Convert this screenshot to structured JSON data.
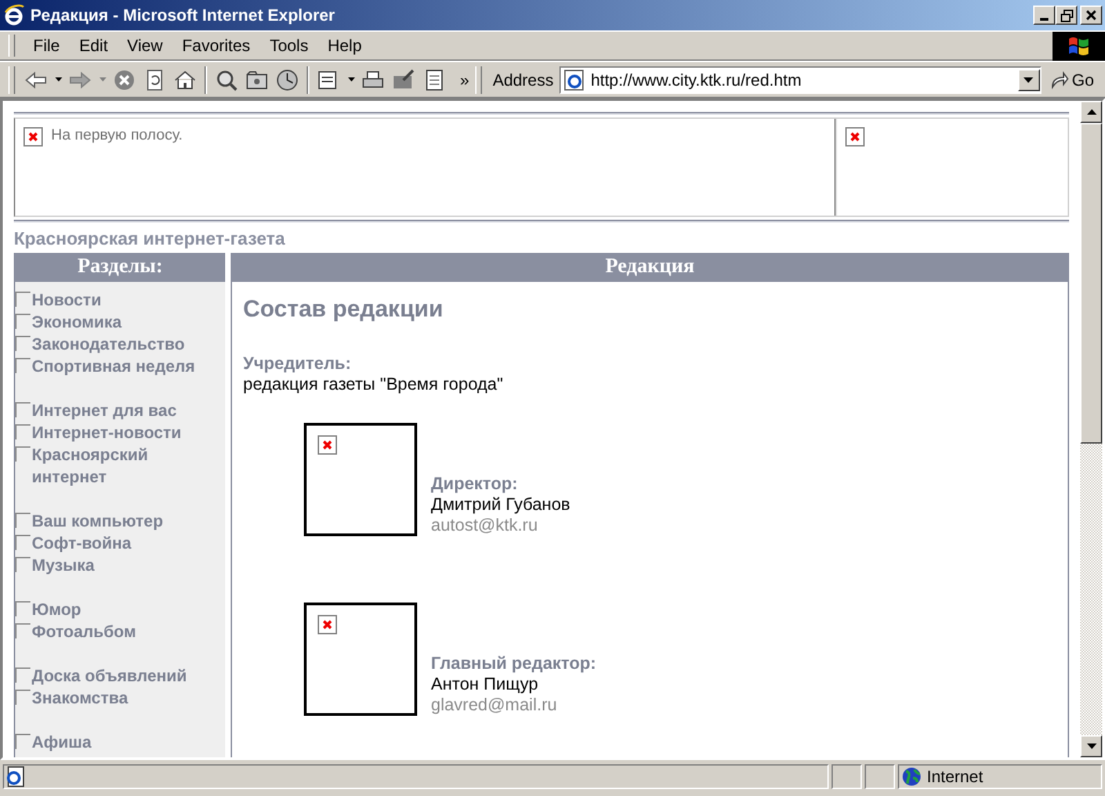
{
  "window": {
    "title": "Редакция - Microsoft Internet Explorer"
  },
  "menu": [
    "File",
    "Edit",
    "View",
    "Favorites",
    "Tools",
    "Help"
  ],
  "toolbar": {
    "more": "»",
    "address_label": "Address",
    "address": "http://www.city.ktk.ru/red.htm",
    "go": "Go"
  },
  "banner": {
    "alt_text": "На первую полосу."
  },
  "site_title": "Красноярская интернет-газета",
  "sidebar": {
    "heading": "Разделы:",
    "groups": [
      [
        "Новости",
        "Экономика",
        "Законодательство",
        "Спортивная неделя"
      ],
      [
        "Интернет для вас",
        "Интернет-новости",
        "Красноярский интернет"
      ],
      [
        "Ваш компьютер",
        "Софт-война",
        "Музыка"
      ],
      [
        "Юмор",
        "Фотоальбом"
      ],
      [
        "Доска объявлений",
        "Знакомства"
      ],
      [
        "Афиша"
      ]
    ]
  },
  "content": {
    "heading": "Редакция",
    "title": "Состав редакции",
    "founder_label": "Учредитель:",
    "founder": "редакция газеты \"Время города\"",
    "staff": [
      {
        "role": "Директор:",
        "name": "Дмитрий Губанов",
        "email": "autost@ktk.ru"
      },
      {
        "role": "Главный редактор:",
        "name": "Антон Пищур",
        "email": "glavred@mail.ru"
      }
    ]
  },
  "status_bar": {
    "zone": "Internet"
  }
}
